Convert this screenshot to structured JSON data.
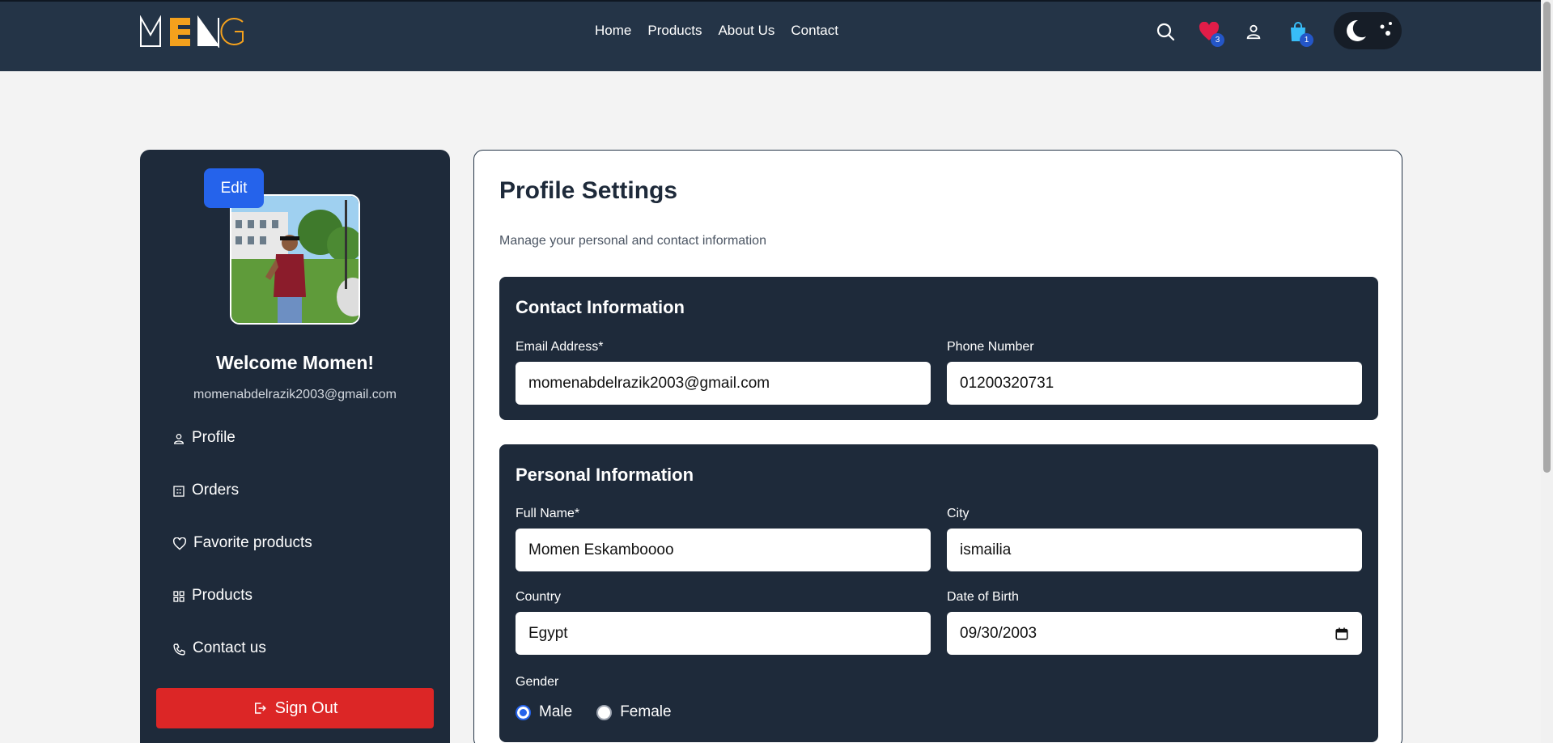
{
  "header": {
    "logo_text": "MENG",
    "nav": [
      "Home",
      "Products",
      "About Us",
      "Contact"
    ],
    "favorites_count": "3",
    "cart_count": "1"
  },
  "sidebar": {
    "edit_label": "Edit",
    "welcome": "Welcome Momen!",
    "email": "momenabdelrazik2003@gmail.com",
    "menu": [
      {
        "label": "Profile",
        "icon": "user-icon"
      },
      {
        "label": "Orders",
        "icon": "orders-icon"
      },
      {
        "label": "Favorite products",
        "icon": "heart-icon"
      },
      {
        "label": "Products",
        "icon": "grid-icon"
      },
      {
        "label": "Contact us",
        "icon": "phone-icon"
      }
    ],
    "signout_label": "Sign Out"
  },
  "main": {
    "title": "Profile Settings",
    "subtitle": "Manage your personal and contact information",
    "contact": {
      "title": "Contact Information",
      "email_label": "Email Address*",
      "email_value": "momenabdelrazik2003@gmail.com",
      "phone_label": "Phone Number",
      "phone_value": "01200320731"
    },
    "personal": {
      "title": "Personal Information",
      "fullname_label": "Full Name*",
      "fullname_value": "Momen Eskamboooo",
      "city_label": "City",
      "city_value": "ismailia",
      "country_label": "Country",
      "country_value": "Egypt",
      "dob_label": "Date of Birth",
      "dob_value": "09/30/2003",
      "gender_label": "Gender",
      "gender_options": [
        "Male",
        "Female"
      ],
      "gender_selected": "Male"
    }
  },
  "colors": {
    "header_bg": "#243447",
    "card_bg": "#1e2a3a",
    "accent": "#2563eb",
    "danger": "#dc2626",
    "logo_orange": "#f4a11d"
  }
}
